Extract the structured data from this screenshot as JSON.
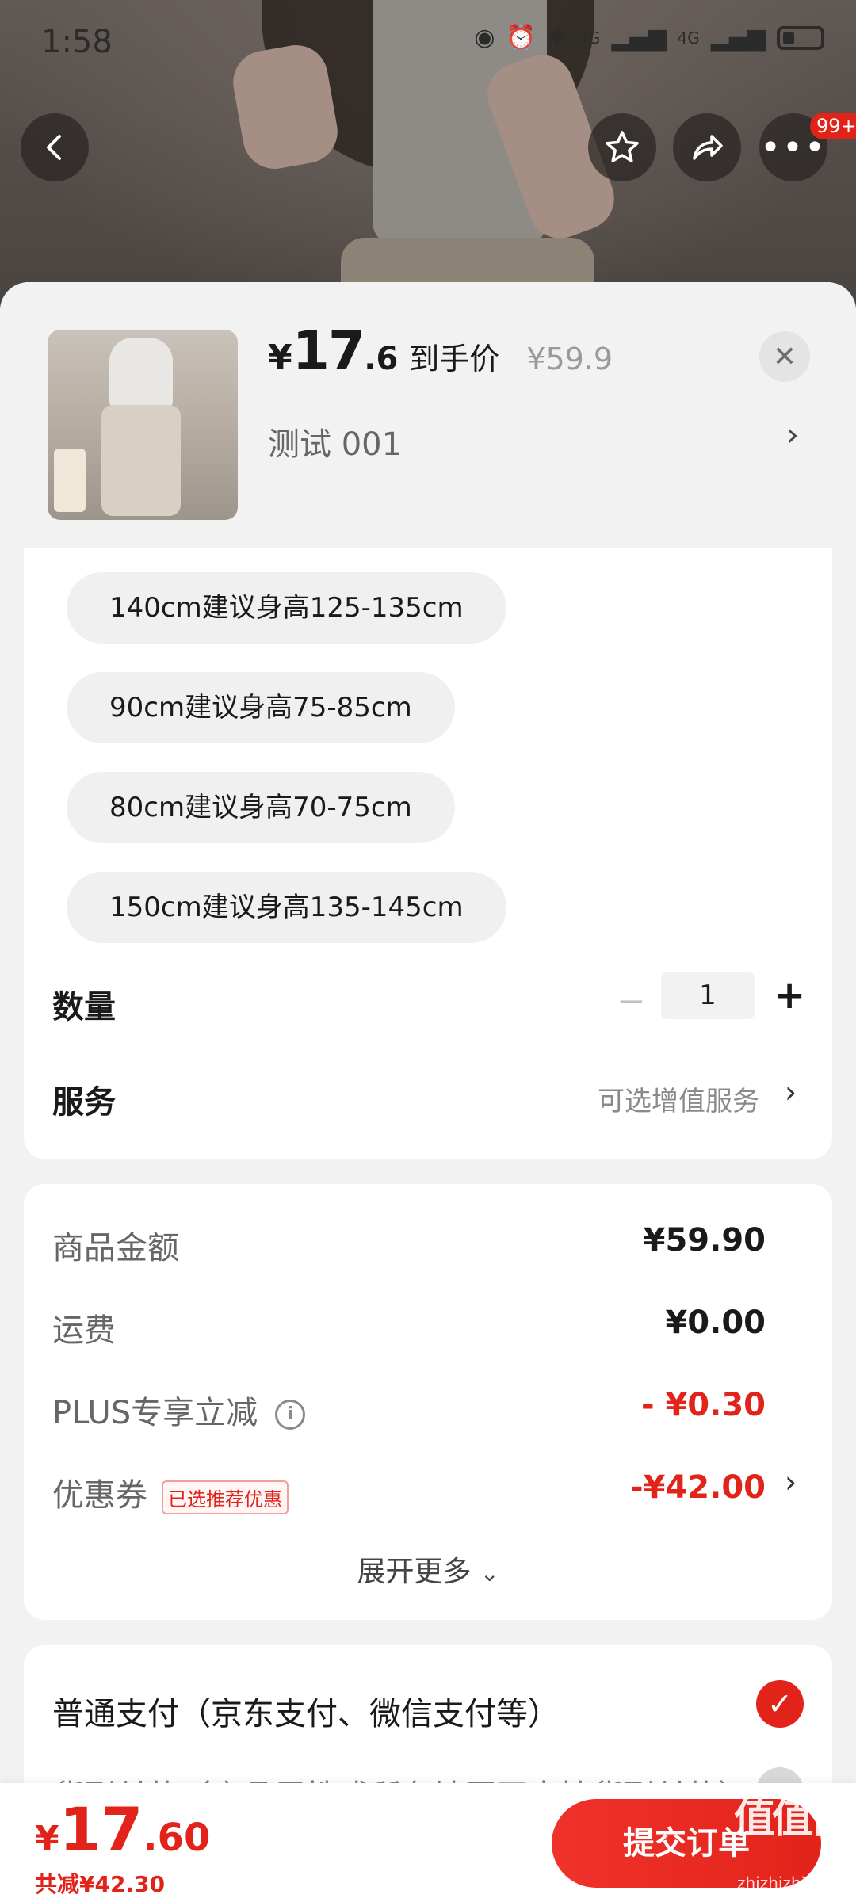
{
  "status_bar": {
    "time": "1:58",
    "network_1": "4G",
    "network_2": "4G"
  },
  "top_actions": {
    "more_badge": "99+"
  },
  "product": {
    "price_symbol": "¥",
    "price_integer": "17",
    "price_decimal": ".6",
    "price_tag": "到手价",
    "original_price": "¥59.9",
    "spec_selected": "测试  001"
  },
  "size_options": [
    "140cm建议身高125-135cm",
    "90cm建议身高75-85cm",
    "80cm建议身高70-75cm",
    "150cm建议身高135-145cm"
  ],
  "quantity": {
    "label": "数量",
    "value": "1",
    "minus": "−",
    "plus": "+"
  },
  "service": {
    "label": "服务",
    "hint": "可选增值服务"
  },
  "amounts": {
    "goods_label": "商品金额",
    "goods_value": "¥59.90",
    "shipping_label": "运费",
    "shipping_value": "¥0.00",
    "plus_label": "PLUS专享立减",
    "plus_value": "- ¥0.30",
    "coupon_label": "优惠券",
    "coupon_badge": "已选推荐优惠",
    "coupon_value": "-¥42.00",
    "expand_more": "展开更多"
  },
  "payment": {
    "option_1": "普通支付（京东支付、微信支付等）",
    "option_2": "货到付款（商品属性或所在地区不支持货到付款）"
  },
  "bottom": {
    "total_symbol": "¥",
    "total_integer": "17",
    "total_decimal": ".60",
    "saved": "共减¥42.30",
    "submit": "提交订单",
    "watermark": "值值值",
    "watermark_sub": "zhizhizhi.com"
  },
  "colors": {
    "accent": "#e2231a",
    "sheet_bg": "#f2f2f2",
    "card_bg": "#ffffff"
  }
}
